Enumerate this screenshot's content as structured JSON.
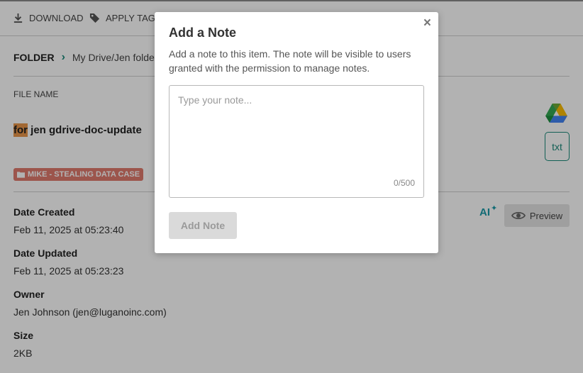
{
  "toolbar": {
    "download_label": "DOWNLOAD",
    "apply_tag_label": "APPLY TAG"
  },
  "breadcrumb": {
    "folder_label": "FOLDER",
    "path": "My Drive/Jen folde"
  },
  "file": {
    "name_label": "FILE NAME",
    "name_highlight": "for",
    "name_rest": " jen gdrive-doc-update",
    "type_badge": "txt",
    "tag": "MIKE - STEALING DATA CASE"
  },
  "metadata": {
    "date_created_label": "Date Created",
    "date_created": "Feb 11, 2025 at 05:23:40",
    "date_updated_label": "Date Updated",
    "date_updated": "Feb 11, 2025 at 05:23:23",
    "owner_label": "Owner",
    "owner": "Jen Johnson (jen@luganoinc.com)",
    "size_label": "Size",
    "size": "2KB"
  },
  "actions": {
    "ai_label": "AI",
    "preview_label": "Preview"
  },
  "modal": {
    "close_symbol": "×",
    "title": "Add a Note",
    "description": "Add a note to this item. The note will be visible to users granted with the permission to manage notes.",
    "note_placeholder": "Type your note...",
    "note_value": "",
    "char_count": "0/500",
    "add_button_label": "Add Note"
  },
  "colors": {
    "accent": "#1a8a7a",
    "tag_bg": "#e07a6e",
    "highlight": "#e8964a"
  },
  "icons": {
    "download": "download-icon",
    "tag": "tag-icon",
    "folder": "folder-icon",
    "gdrive": "google-drive-icon",
    "eye": "eye-icon",
    "ai": "ai-sparkle-icon",
    "close": "close-icon"
  }
}
